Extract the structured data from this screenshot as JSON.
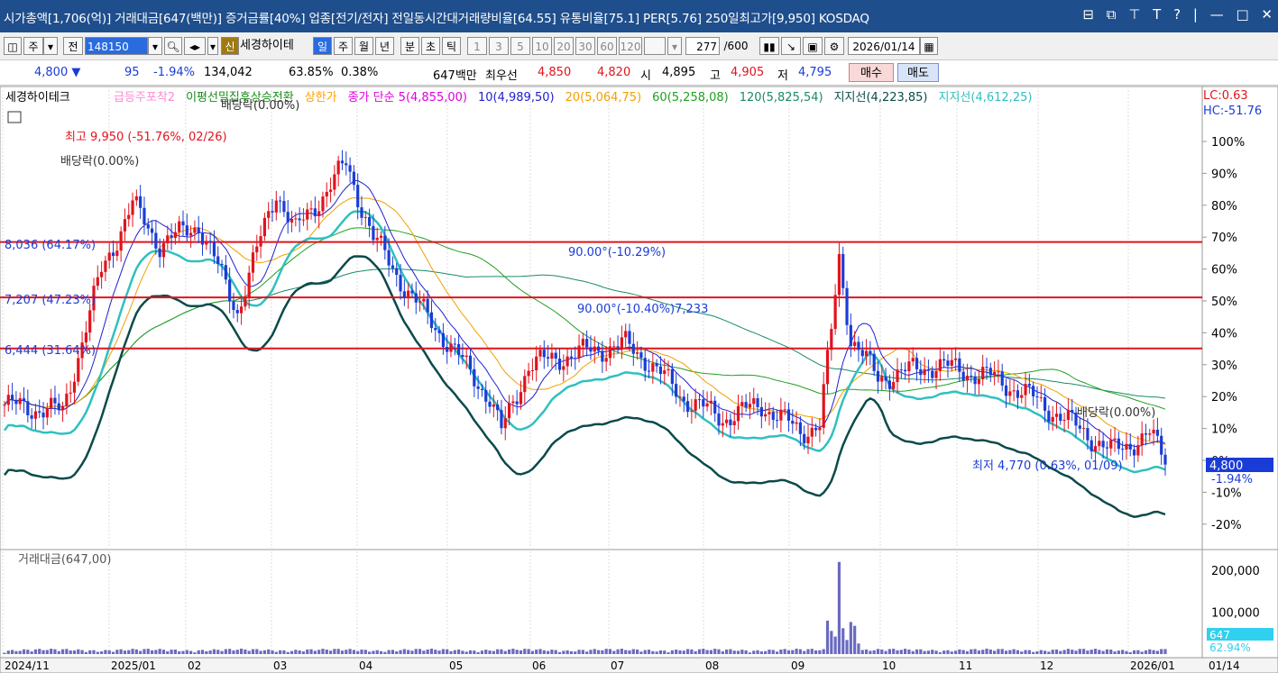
{
  "titlebar": {
    "text": "시가총액[1,706(억)] 거래대금[647(백만)] 증거금률[40%] 업종[전기/전자] 전일동시간대거래량비율[64.55] 유통비율[75.1] PER[5.76] 250일최고가[9,950] KOSDAQ",
    "controls": [
      "⊟",
      "⧉",
      "⊤",
      "T",
      "?",
      "|",
      "—",
      "□",
      "✕"
    ]
  },
  "toolbar": {
    "type_label": "주",
    "prev_label": "전",
    "code": "148150",
    "new_badge": "신",
    "stock_name": "세경하이테",
    "periods": [
      "일",
      "주",
      "월",
      "년",
      "분",
      "초",
      "틱"
    ],
    "active_period": "일",
    "intervals": [
      "1",
      "3",
      "5",
      "10",
      "20",
      "30",
      "60",
      "120"
    ],
    "count_value": "277",
    "count_total": "/600",
    "date": "2026/01/14"
  },
  "quote": {
    "price": "4,800 ▼",
    "change": "95",
    "change_pct": "-1.94%",
    "volume": "134,042",
    "vol_ratio": "63.85%",
    "turnover": "0.38%",
    "amount": "647백만",
    "best_label": "최우선",
    "ask": "4,850",
    "bid": "4,820",
    "open_label": "시",
    "open": "4,895",
    "high_label": "고",
    "high": "4,905",
    "low_label": "저",
    "low": "4,795",
    "buy_label": "매수",
    "sell_label": "매도"
  },
  "legend": {
    "name": "세경하이테크",
    "items": [
      {
        "text": "급등주포착2",
        "color": "#ff8ad0"
      },
      {
        "text": "이평선밀집후상승전환",
        "color": "#1a8a1a"
      },
      {
        "text": "상한가",
        "color": "#ffa000"
      },
      {
        "text": "종가 단순 5(4,855,00)",
        "color": "#e000e0"
      },
      {
        "text": "10(4,989,50)",
        "color": "#2020d0"
      },
      {
        "text": "20(5,064,75)",
        "color": "#f0a000"
      },
      {
        "text": "60(5,258,08)",
        "color": "#20a020"
      },
      {
        "text": "120(5,825,54)",
        "color": "#1a8a6a"
      },
      {
        "text": "지지선(4,223,85)",
        "color": "#0b4a4a"
      },
      {
        "text": "지지선(4,612,25)",
        "color": "#30c0c0"
      }
    ]
  },
  "annotations": {
    "high": "최고 9,950 (-51.76%, 02/26)",
    "low": "최저 4,770 (0.63%, 01/09)",
    "dividend1": "배당락(0.00%)",
    "dividend2": "배당락(0.00%)",
    "dividend3": "배당락(0.00%)",
    "hl1": "8,036 (64.17%)",
    "hl2": "7,207 (47.23%)",
    "hl3": "6,444 (31.64%)",
    "angle1": "90.00°(-10.29%)",
    "angle2": "90.00°(-10.40%)7,233",
    "price_tag": "4,800",
    "pct_tag": "-1.94%",
    "lc": "LC:0.63",
    "hc": "HC:-51.76"
  },
  "colors": {
    "up": "#e0141e",
    "down": "#1a3cd6",
    "hline": "#e0141e",
    "title_bg": "#1f4e8c"
  },
  "chart_data": {
    "type": "candlestick",
    "yaxis_ticks": [
      "100%",
      "90%",
      "80%",
      "70%",
      "60%",
      "50%",
      "40%",
      "30%",
      "20%",
      "10%",
      "0%",
      "-10%",
      "-20%"
    ],
    "xaxis_ticks": [
      "2024/11",
      "2025/01",
      "02",
      "03",
      "04",
      "05",
      "06",
      "07",
      "08",
      "09",
      "10",
      "11",
      "12",
      "2026/01",
      "01/14"
    ],
    "volume_title": "거래대금(647,00)",
    "volume_ticks": [
      "200,000",
      "100,000"
    ],
    "volume_tag": "647",
    "volume_pct_tag": "62.94%",
    "horizontal_lines": [
      8036,
      7207,
      6444
    ],
    "last_close": 4800,
    "period_high": 9950,
    "period_low": 4770,
    "volume_peak": 220000
  }
}
